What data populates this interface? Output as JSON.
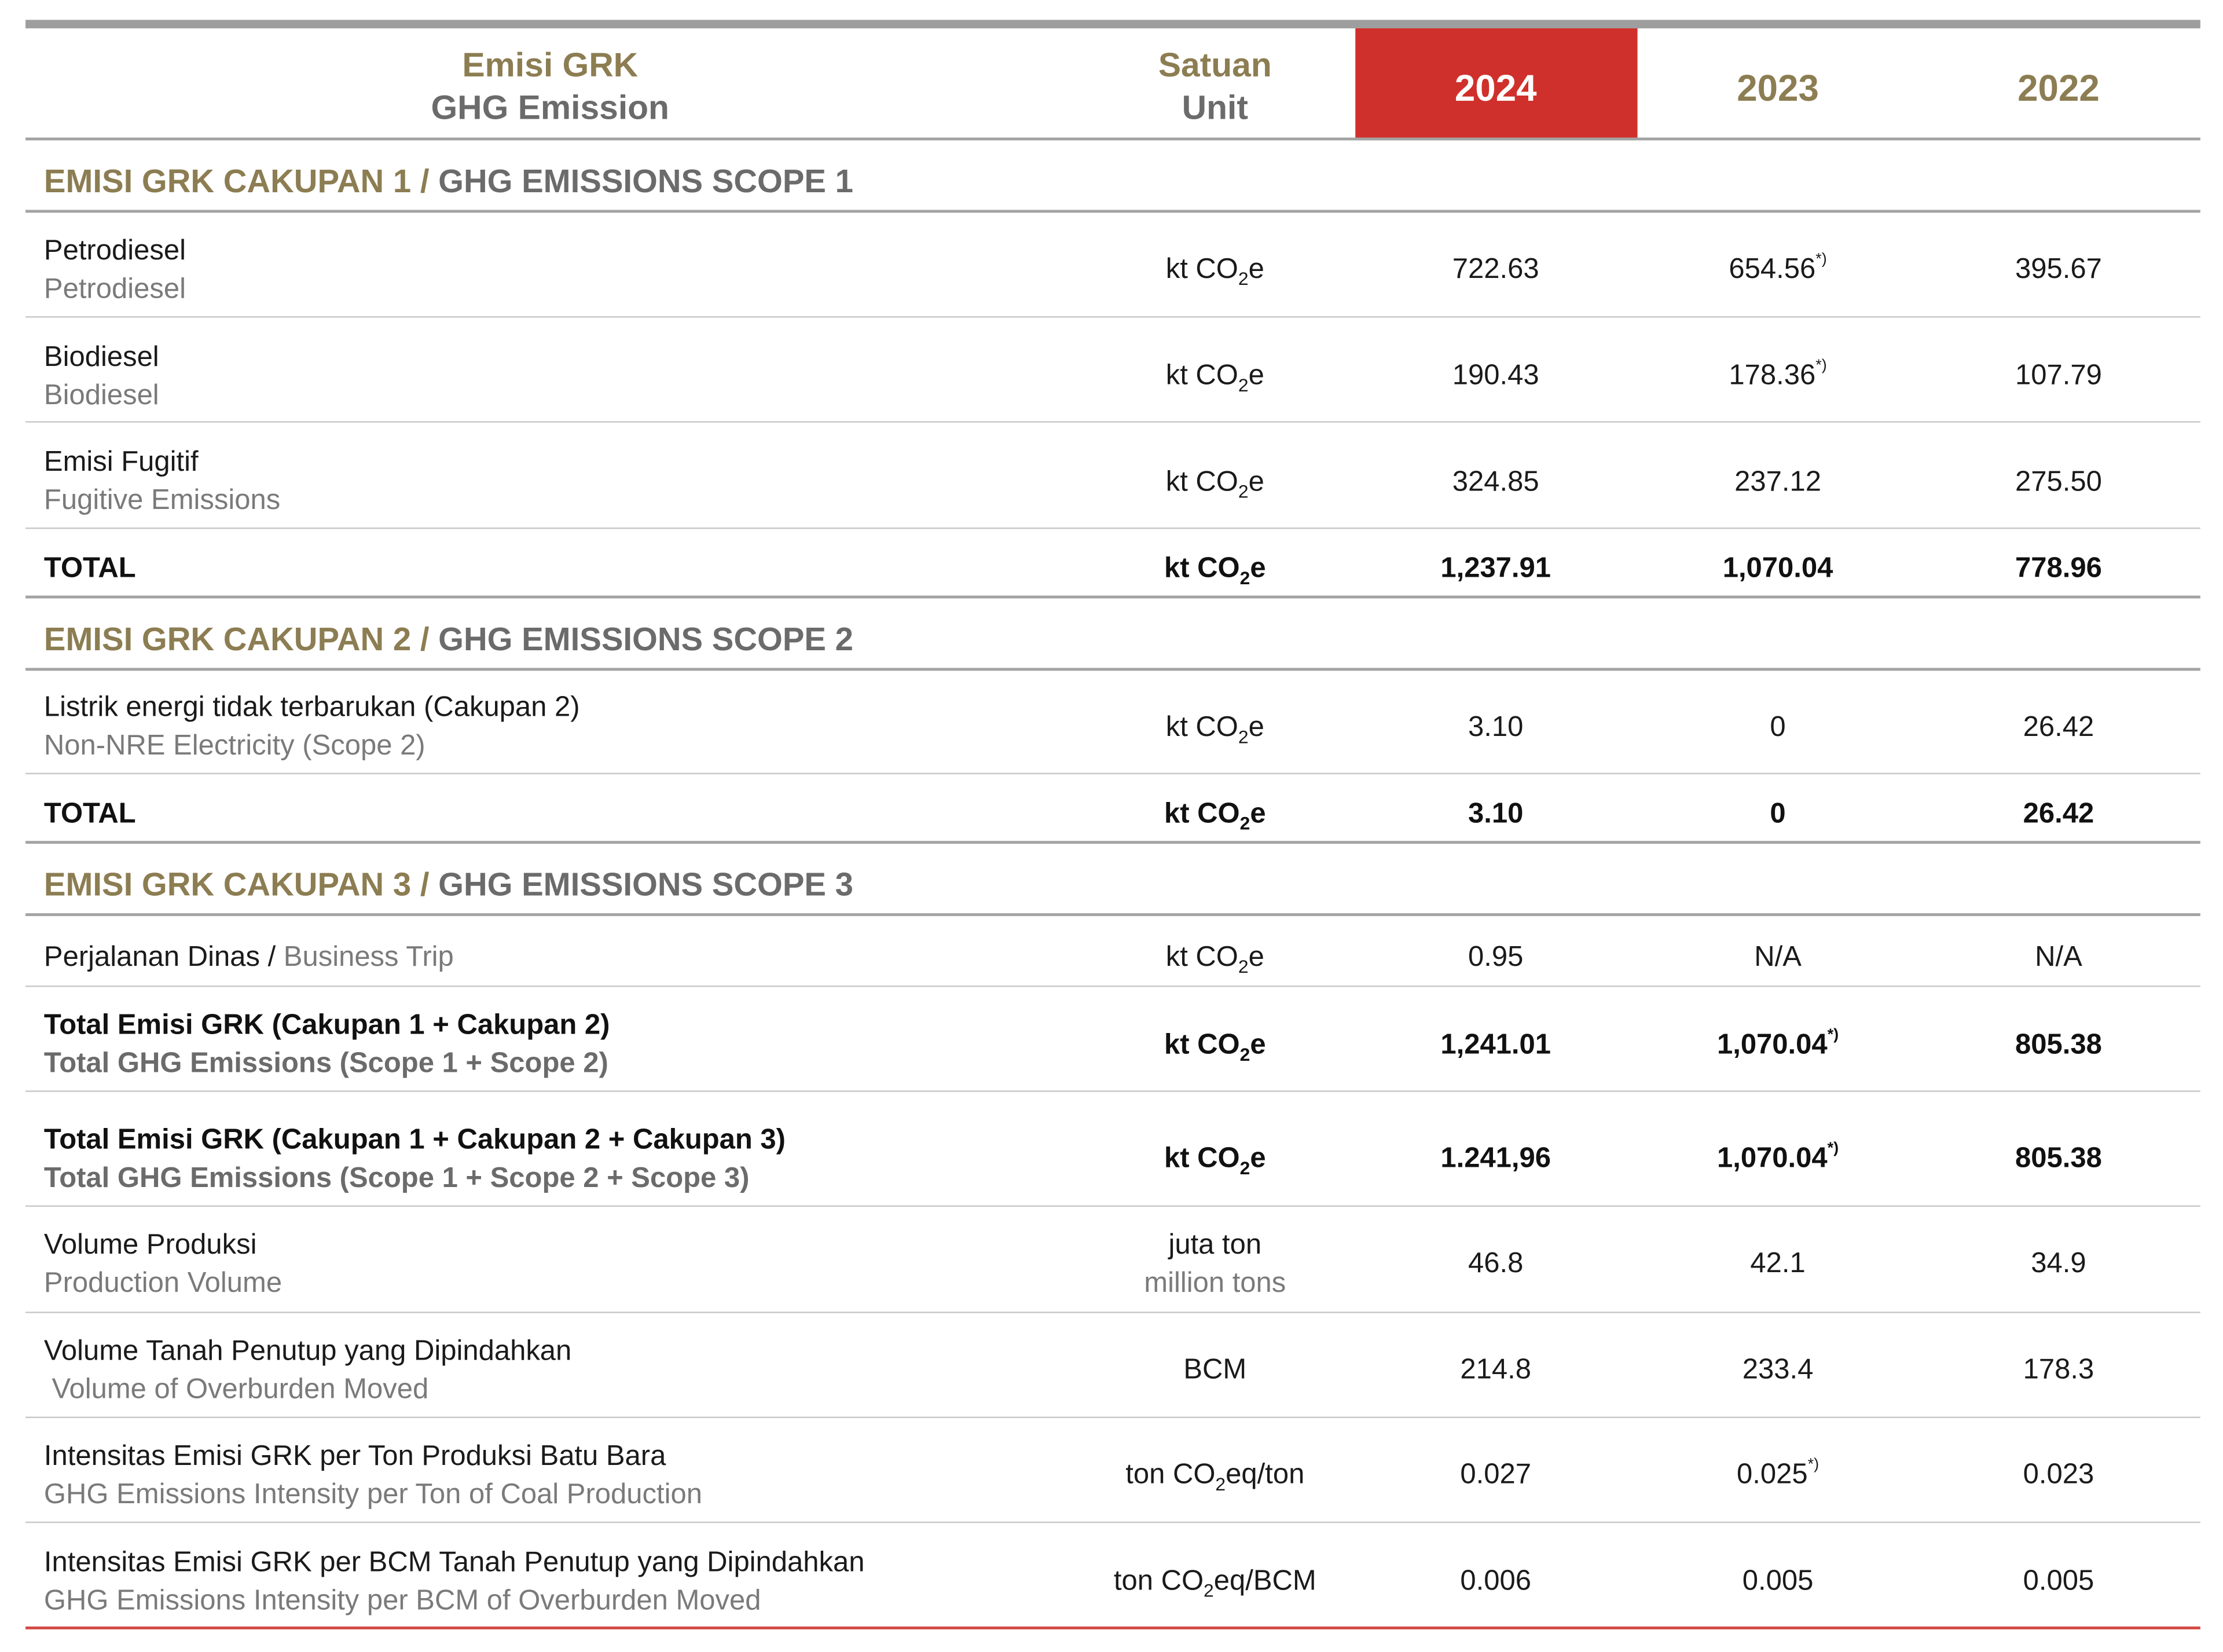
{
  "header": {
    "col_emission_id": "Emisi GRK",
    "col_emission_en": "GHG Emission",
    "col_unit_id": "Satuan",
    "col_unit_en": "Unit",
    "years": [
      "2024",
      "2023",
      "2022"
    ]
  },
  "units": {
    "kt": "kt CO",
    "kt_sub": "2",
    "kt_tail": "e",
    "juta_ton": "juta ton",
    "million_tons": "million tons",
    "bcm": "BCM",
    "ton_prefix": "ton CO",
    "ton_sub": "2",
    "ton_tail_ton": "eq/ton",
    "ton_tail_bcm": "eq/BCM"
  },
  "footnote_mark": "*)",
  "scope1": {
    "title_id": "EMISI GRK CAKUPAN 1",
    "separator": " / ",
    "title_en": "GHG EMISSIONS SCOPE 1",
    "rows": [
      {
        "label_id": "Petrodiesel",
        "label_en": "Petrodiesel",
        "v2024": "722.63",
        "v2023": "654.56",
        "v2022": "395.67"
      },
      {
        "label_id": "Biodiesel",
        "label_en": "Biodiesel",
        "v2024": "190.43",
        "v2023": "178.36",
        "v2022": "107.79"
      },
      {
        "label_id": "Emisi Fugitif",
        "label_en": "Fugitive Emissions",
        "v2024": "324.85",
        "v2023": "237.12",
        "v2022": "275.50"
      }
    ],
    "total": {
      "label": "TOTAL",
      "v2024": "1,237.91",
      "v2023": "1,070.04",
      "v2022": "778.96"
    }
  },
  "scope2": {
    "title_id": "EMISI GRK CAKUPAN 2",
    "separator": " / ",
    "title_en": "GHG EMISSIONS SCOPE 2",
    "rows": [
      {
        "label_id": "Listrik energi tidak terbarukan  (Cakupan 2)",
        "label_en": "Non-NRE Electricity (Scope 2)",
        "v2024": "3.10",
        "v2023": "0",
        "v2022": "26.42"
      }
    ],
    "total": {
      "label": "TOTAL",
      "v2024": "3.10",
      "v2023": "0",
      "v2022": "26.42"
    }
  },
  "scope3": {
    "title_id": "EMISI GRK CAKUPAN 3",
    "separator": " / ",
    "title_en": "GHG EMISSIONS SCOPE 3",
    "business_trip": {
      "label_id": "Perjalanan Dinas",
      "separator": " / ",
      "label_en": "Business Trip",
      "v2024": "0.95",
      "v2023": "N/A",
      "v2022": "N/A"
    }
  },
  "totals": [
    {
      "label_id": "Total Emisi GRK (Cakupan 1 + Cakupan 2)",
      "label_en": "Total GHG Emissions (Scope 1 + Scope 2)",
      "v2024": "1,241.01",
      "v2023": "1,070.04",
      "v2022": "805.38"
    },
    {
      "label_id": "Total Emisi GRK (Cakupan 1 + Cakupan 2 + Cakupan 3)",
      "label_en": "Total GHG Emissions (Scope 1 + Scope 2 + Scope 3)",
      "v2024": "1.241,96",
      "v2023": "1,070.04",
      "v2022": "805.38"
    }
  ],
  "others": [
    {
      "label_id": "Volume Produksi",
      "label_en": "Production Volume",
      "v2024": "46.8",
      "v2023": "42.1",
      "v2022": "34.9"
    },
    {
      "label_id": "Volume Tanah Penutup yang Dipindahkan",
      "label_en": " Volume of Overburden Moved",
      "v2024": "214.8",
      "v2023": "233.4",
      "v2022": "178.3"
    },
    {
      "label_id": "Intensitas Emisi GRK per Ton Produksi Batu Bara",
      "label_en": "GHG Emissions Intensity per Ton of Coal Production",
      "v2024": "0.027",
      "v2023": "0.025",
      "v2022": "0.023"
    },
    {
      "label_id": "Intensitas Emisi GRK per BCM Tanah Penutup yang Dipindahkan",
      "label_en": "GHG Emissions Intensity per BCM of Overburden Moved",
      "v2024": "0.006",
      "v2023": "0.005",
      "v2022": "0.005"
    }
  ]
}
